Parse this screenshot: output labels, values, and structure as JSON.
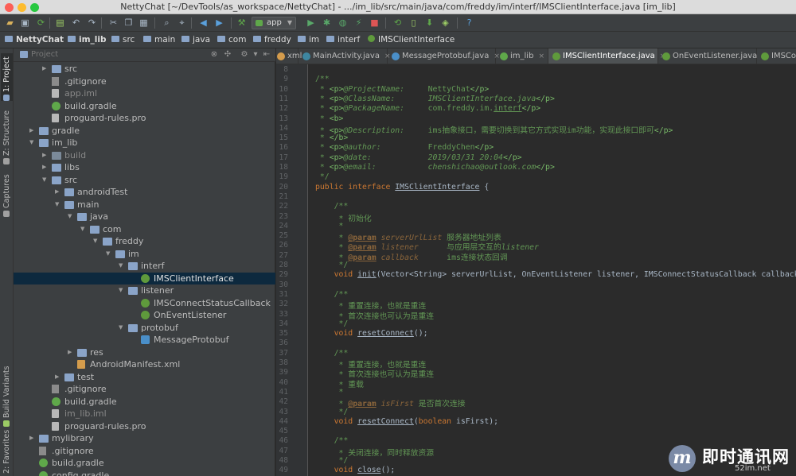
{
  "window": {
    "title": "NettyChat [~/DevTools/as_workspace/NettyChat] - .../im_lib/src/main/java/com/freddy/im/interf/IMSClientInterface.java [im_lib]"
  },
  "toolbar": {
    "run_config": "app"
  },
  "breadcrumb": [
    "NettyChat",
    "im_lib",
    "src",
    "main",
    "java",
    "com",
    "freddy",
    "im",
    "interf",
    "IMSClientInterface"
  ],
  "left_strip": {
    "project": "1: Project",
    "structure": "Z: Structure",
    "captures": "Captures",
    "build_variants": "Build Variants",
    "favorites": "2: Favorites"
  },
  "project_panel": {
    "header": "Project"
  },
  "tree": [
    {
      "label": "src",
      "depth": 2,
      "arrow": "right",
      "icon": "folder"
    },
    {
      "label": ".gitignore",
      "depth": 2,
      "arrow": "",
      "icon": "git"
    },
    {
      "label": "app.iml",
      "depth": 2,
      "arrow": "",
      "icon": "file",
      "dim": true
    },
    {
      "label": "build.gradle",
      "depth": 2,
      "arrow": "",
      "icon": "gradle"
    },
    {
      "label": "proguard-rules.pro",
      "depth": 2,
      "arrow": "",
      "icon": "file"
    },
    {
      "label": "gradle",
      "depth": 1,
      "arrow": "right",
      "icon": "folder"
    },
    {
      "label": "im_lib",
      "depth": 1,
      "arrow": "down",
      "icon": "folder"
    },
    {
      "label": "build",
      "depth": 2,
      "arrow": "right",
      "icon": "folder-grey",
      "dim": true
    },
    {
      "label": "libs",
      "depth": 2,
      "arrow": "right",
      "icon": "folder"
    },
    {
      "label": "src",
      "depth": 2,
      "arrow": "down",
      "icon": "folder"
    },
    {
      "label": "androidTest",
      "depth": 3,
      "arrow": "right",
      "icon": "folder"
    },
    {
      "label": "main",
      "depth": 3,
      "arrow": "down",
      "icon": "folder"
    },
    {
      "label": "java",
      "depth": 4,
      "arrow": "down",
      "icon": "folder"
    },
    {
      "label": "com",
      "depth": 5,
      "arrow": "down",
      "icon": "folder"
    },
    {
      "label": "freddy",
      "depth": 6,
      "arrow": "down",
      "icon": "folder"
    },
    {
      "label": "im",
      "depth": 7,
      "arrow": "down",
      "icon": "folder"
    },
    {
      "label": "interf",
      "depth": 8,
      "arrow": "down",
      "icon": "folder"
    },
    {
      "label": "IMSClientInterface",
      "depth": 9,
      "arrow": "",
      "icon": "iface",
      "selected": true
    },
    {
      "label": "listener",
      "depth": 8,
      "arrow": "down",
      "icon": "folder"
    },
    {
      "label": "IMSConnectStatusCallback",
      "depth": 9,
      "arrow": "",
      "icon": "iface"
    },
    {
      "label": "OnEventListener",
      "depth": 9,
      "arrow": "",
      "icon": "iface"
    },
    {
      "label": "protobuf",
      "depth": 8,
      "arrow": "down",
      "icon": "folder"
    },
    {
      "label": "MessageProtobuf",
      "depth": 9,
      "arrow": "",
      "icon": "pb"
    },
    {
      "label": "res",
      "depth": 4,
      "arrow": "right",
      "icon": "folder"
    },
    {
      "label": "AndroidManifest.xml",
      "depth": 4,
      "arrow": "",
      "icon": "xml"
    },
    {
      "label": "test",
      "depth": 3,
      "arrow": "right",
      "icon": "folder"
    },
    {
      "label": ".gitignore",
      "depth": 2,
      "arrow": "",
      "icon": "git"
    },
    {
      "label": "build.gradle",
      "depth": 2,
      "arrow": "",
      "icon": "gradle"
    },
    {
      "label": "im_lib.iml",
      "depth": 2,
      "arrow": "",
      "icon": "file",
      "dim": true
    },
    {
      "label": "proguard-rules.pro",
      "depth": 2,
      "arrow": "",
      "icon": "file"
    },
    {
      "label": "mylibrary",
      "depth": 1,
      "arrow": "right",
      "icon": "folder"
    },
    {
      "label": ".gitignore",
      "depth": 1,
      "arrow": "",
      "icon": "git"
    },
    {
      "label": "build.gradle",
      "depth": 1,
      "arrow": "",
      "icon": "gradle"
    },
    {
      "label": "config.gradle",
      "depth": 1,
      "arrow": "",
      "icon": "gradle"
    }
  ],
  "tabs": [
    {
      "label": "xml",
      "icon": "xml"
    },
    {
      "label": "MainActivity.java",
      "icon": "cls"
    },
    {
      "label": "MessageProtobuf.java",
      "icon": "pb"
    },
    {
      "label": "im_lib",
      "icon": "gradle"
    },
    {
      "label": "IMSClientInterface.java",
      "icon": "iface",
      "active": true
    },
    {
      "label": "OnEventListener.java",
      "icon": "iface"
    },
    {
      "label": "IMSCo",
      "icon": "iface"
    }
  ],
  "code_lines": [
    {
      "n": "8",
      "html": ""
    },
    {
      "n": "9",
      "html": "<span class='doc'>/**</span>"
    },
    {
      "n": "10",
      "html": "<span class='doc'> * <span class='tag'>&lt;p&gt;</span><span class='itl'>@ProjectName:</span>     NettyChat<span class='tag'>&lt;/p&gt;</span></span>"
    },
    {
      "n": "11",
      "html": "<span class='doc'> * <span class='tag'>&lt;p&gt;</span><span class='itl'>@ClassName:</span>       <span class='itl'>IMSClientInterface.java</span><span class='tag'>&lt;/p&gt;</span></span>"
    },
    {
      "n": "12",
      "html": "<span class='doc'> * <span class='tag'>&lt;p&gt;</span><span class='itl'>@PackageName:</span>     com.freddy.im.<span class='und'>interf</span><span class='tag'>&lt;/p&gt;</span></span>"
    },
    {
      "n": "13",
      "html": "<span class='doc'> * <span class='tag'>&lt;b&gt;</span></span>"
    },
    {
      "n": "14",
      "html": "<span class='doc'> * <span class='tag'>&lt;p&gt;</span><span class='itl'>@Description:</span>     ims抽象接口，需要切换到其它方式实现im功能，实现此接口即可<span class='tag'>&lt;/p&gt;</span></span>"
    },
    {
      "n": "15",
      "html": "<span class='doc'> * <span class='tag'>&lt;/b&gt;</span></span>"
    },
    {
      "n": "16",
      "html": "<span class='doc'> * <span class='tag'>&lt;p&gt;</span><span class='itl'>@author:</span>          FreddyChen<span class='tag'>&lt;/p&gt;</span></span>"
    },
    {
      "n": "17",
      "html": "<span class='doc'> * <span class='tag'>&lt;p&gt;</span><span class='itl'>@date:</span>            <span class='itl'>2019/03/31 20:04</span><span class='tag'>&lt;/p&gt;</span></span>"
    },
    {
      "n": "18",
      "html": "<span class='doc'> * <span class='tag'>&lt;p&gt;</span><span class='itl'>@email:</span>           <span class='itl'>chenshichao@outlook.com</span><span class='tag'>&lt;/p&gt;</span></span>"
    },
    {
      "n": "19",
      "html": "<span class='doc'> */</span>"
    },
    {
      "n": "20",
      "html": "<span class='kw'>public interface</span> <span class='und'>IMSClientInterface</span> {"
    },
    {
      "n": "21",
      "html": ""
    },
    {
      "n": "22",
      "html": "    <span class='doc'>/**</span>"
    },
    {
      "n": "23",
      "html": "    <span class='doc'> * 初始化</span>"
    },
    {
      "n": "24",
      "html": "    <span class='doc'> *</span>"
    },
    {
      "n": "25",
      "html": "    <span class='doc'> * <span class='param'>@param</span> <span class='pname'>serverUrlList</span> 服务器地址列表</span>"
    },
    {
      "n": "26",
      "html": "    <span class='doc'> * <span class='param'>@param</span> <span class='pname'>listener</span>      与应用层交互的<span class='itl'>listener</span></span>"
    },
    {
      "n": "27",
      "html": "    <span class='doc'> * <span class='param'>@param</span> <span class='pname'>callback</span>      ims连接状态回调</span>"
    },
    {
      "n": "28",
      "html": "    <span class='doc'> */</span>"
    },
    {
      "n": "29",
      "html": "    <span class='kw'>void</span> <span class='und'>init</span>(Vector&lt;String&gt; serverUrlList, OnEventListener listener, IMSConnectStatusCallback callback);"
    },
    {
      "n": "30",
      "html": ""
    },
    {
      "n": "31",
      "html": "    <span class='doc'>/**</span>"
    },
    {
      "n": "32",
      "html": "    <span class='doc'> * 重置连接，也就是重连</span>"
    },
    {
      "n": "33",
      "html": "    <span class='doc'> * 首次连接也可认为是重连</span>"
    },
    {
      "n": "34",
      "html": "    <span class='doc'> */</span>"
    },
    {
      "n": "35",
      "html": "    <span class='kw'>void</span> <span class='und'>resetConnect</span>();"
    },
    {
      "n": "36",
      "html": ""
    },
    {
      "n": "37",
      "html": "    <span class='doc'>/**</span>"
    },
    {
      "n": "38",
      "html": "    <span class='doc'> * 重置连接，也就是重连</span>"
    },
    {
      "n": "39",
      "html": "    <span class='doc'> * 首次连接也可认为是重连</span>"
    },
    {
      "n": "40",
      "html": "    <span class='doc'> * 重载</span>"
    },
    {
      "n": "41",
      "html": "    <span class='doc'> *</span>"
    },
    {
      "n": "42",
      "html": "    <span class='doc'> * <span class='param'>@param</span> <span class='pname'>isFirst</span> 是否首次连接</span>"
    },
    {
      "n": "43",
      "html": "    <span class='doc'> */</span>"
    },
    {
      "n": "44",
      "html": "    <span class='kw'>void</span> <span class='und'>resetConnect</span>(<span class='kw'>boolean</span> isFirst);"
    },
    {
      "n": "45",
      "html": ""
    },
    {
      "n": "46",
      "html": "    <span class='doc'>/**</span>"
    },
    {
      "n": "47",
      "html": "    <span class='doc'> * 关闭连接，同时释放资源</span>"
    },
    {
      "n": "48",
      "html": "    <span class='doc'> */</span>"
    },
    {
      "n": "49",
      "html": "    <span class='kw'>void</span> <span class='und'>close</span>();"
    }
  ],
  "watermark": {
    "logo": "m",
    "main": "即时通讯网",
    "sub": "52im.net"
  }
}
